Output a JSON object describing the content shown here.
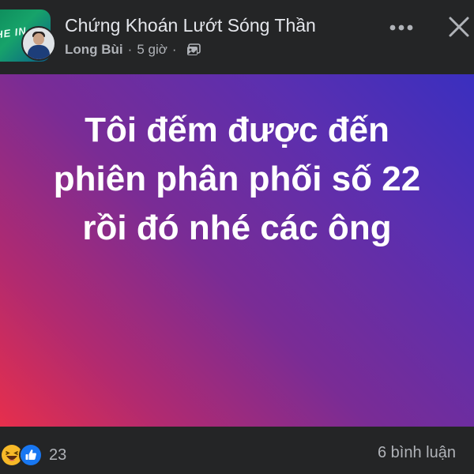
{
  "post": {
    "group_name": "Chứng Khoán Lướt Sóng Thần",
    "author": "Long Bùi",
    "separator": "·",
    "time": "5 giờ",
    "audience_icon": "photo-album-icon",
    "group_avatar_text": "HE IN",
    "body_lines": [
      "Tôi đếm được đến",
      "phiên phân phối số 22",
      "rồi đó nhé các ông"
    ],
    "background_gradient": [
      "#3a2fbf",
      "#7a2c95",
      "#e62f4c"
    ]
  },
  "header_actions": {
    "more_icon": "more-horizontal-icon",
    "close_icon": "close-icon"
  },
  "footer": {
    "reaction_icons": [
      "haha-icon",
      "like-icon"
    ],
    "reaction_count": "23",
    "comment_count": "6 bình luận"
  },
  "colors": {
    "background": "#242526",
    "primary_text": "#e4e6eb",
    "secondary_text": "#b0b3b8",
    "like_blue": "#1877f2",
    "haha_yellow": "#f7b928"
  }
}
